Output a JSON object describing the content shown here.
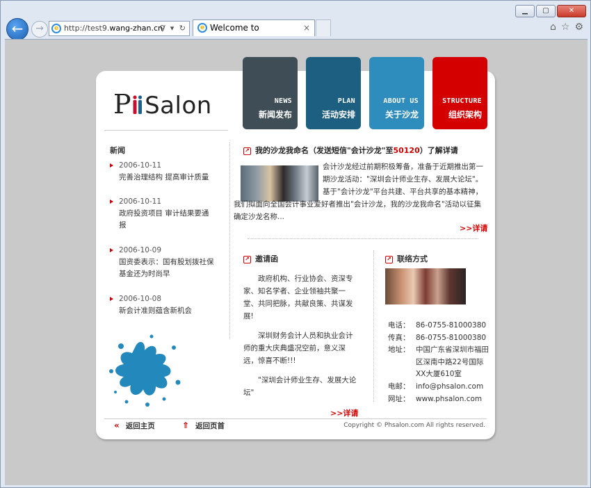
{
  "browser": {
    "url_prefix": "http://test9.",
    "url_domain": "wang-zhan.cn",
    "url_suffix": "/",
    "tab_title": "Welcome to www.PhSalo...",
    "back_glyph": "←",
    "forward_glyph": "→",
    "addr_tools": "⚲ ▾ ↻",
    "tab_close": "×",
    "home_glyph": "⌂",
    "favorites_glyph": "☆",
    "settings_glyph": "⚙"
  },
  "logo": {
    "p": "P",
    "text": "Salon"
  },
  "nav": [
    {
      "en": "NEWS",
      "zh": "新闻发布",
      "color": "#3f4d56"
    },
    {
      "en": "PLAN",
      "zh": "活动安排",
      "color": "#1c5f80"
    },
    {
      "en": "ABOUT US",
      "zh": "关于沙龙",
      "color": "#2e8dbd"
    },
    {
      "en": "STRUCTURE",
      "zh": "组织架构",
      "color": "#d40000"
    }
  ],
  "left": {
    "title": "新闻",
    "items": [
      {
        "date": "2006-10-11",
        "text": "完善治理结构 提高审计质量"
      },
      {
        "date": "2006-10-11",
        "text": "政府投资项目 审计结果要通报"
      },
      {
        "date": "2006-10-09",
        "text": "国资委表示：国有股划拨社保基金还为时尚早"
      },
      {
        "date": "2006-10-08",
        "text": "新会计准则蕴含新机会"
      }
    ]
  },
  "main": {
    "head_pre": "我的沙龙我命名（发送短信\"会计沙龙\"至",
    "head_num": "50120",
    "head_post": "）了解详请",
    "body": "会计沙龙经过前期积极筹备，准备于近期推出第一期沙龙活动：\"深圳会计师业生存、发展大论坛\"。基于\"会计沙龙\"平台共建、平台共享的基本精神，我们拟面向全国会计事业爱好者推出\"会计沙龙，我的沙龙我命名\"活动以征集确定沙龙名称...",
    "more": ">>详请"
  },
  "invite": {
    "title": "邀请函",
    "p1": "政府机构、行业协会、资深专家、知名学者、企业领袖共聚一堂、共同把脉，共献良策、共谋发展!",
    "p2": "深圳财务会计人员和执业会计师的重大庆典盛况空前，意义深远，惊喜不断!!!",
    "p3": "\"深圳会计师业生存、发展大论坛\"",
    "more": ">>详请"
  },
  "contact": {
    "title": "联络方式",
    "rows": [
      {
        "label": "电话：",
        "value": "86-0755-81000380"
      },
      {
        "label": "传真：",
        "value": "86-0755-81000380"
      },
      {
        "label": "地址：",
        "value": "中国广东省深圳市福田区深南中路22号国际XX大厦610室"
      },
      {
        "label": "电邮：",
        "value": "info@phsalon.com"
      },
      {
        "label": "网址：",
        "value": "www.phsalon.com"
      }
    ]
  },
  "footer": {
    "home": "返回主页",
    "top": "返回页首",
    "home_icon": "«",
    "top_icon": "⇑",
    "copyright": "Copyright © Phsalon.com  All rights reserved."
  }
}
